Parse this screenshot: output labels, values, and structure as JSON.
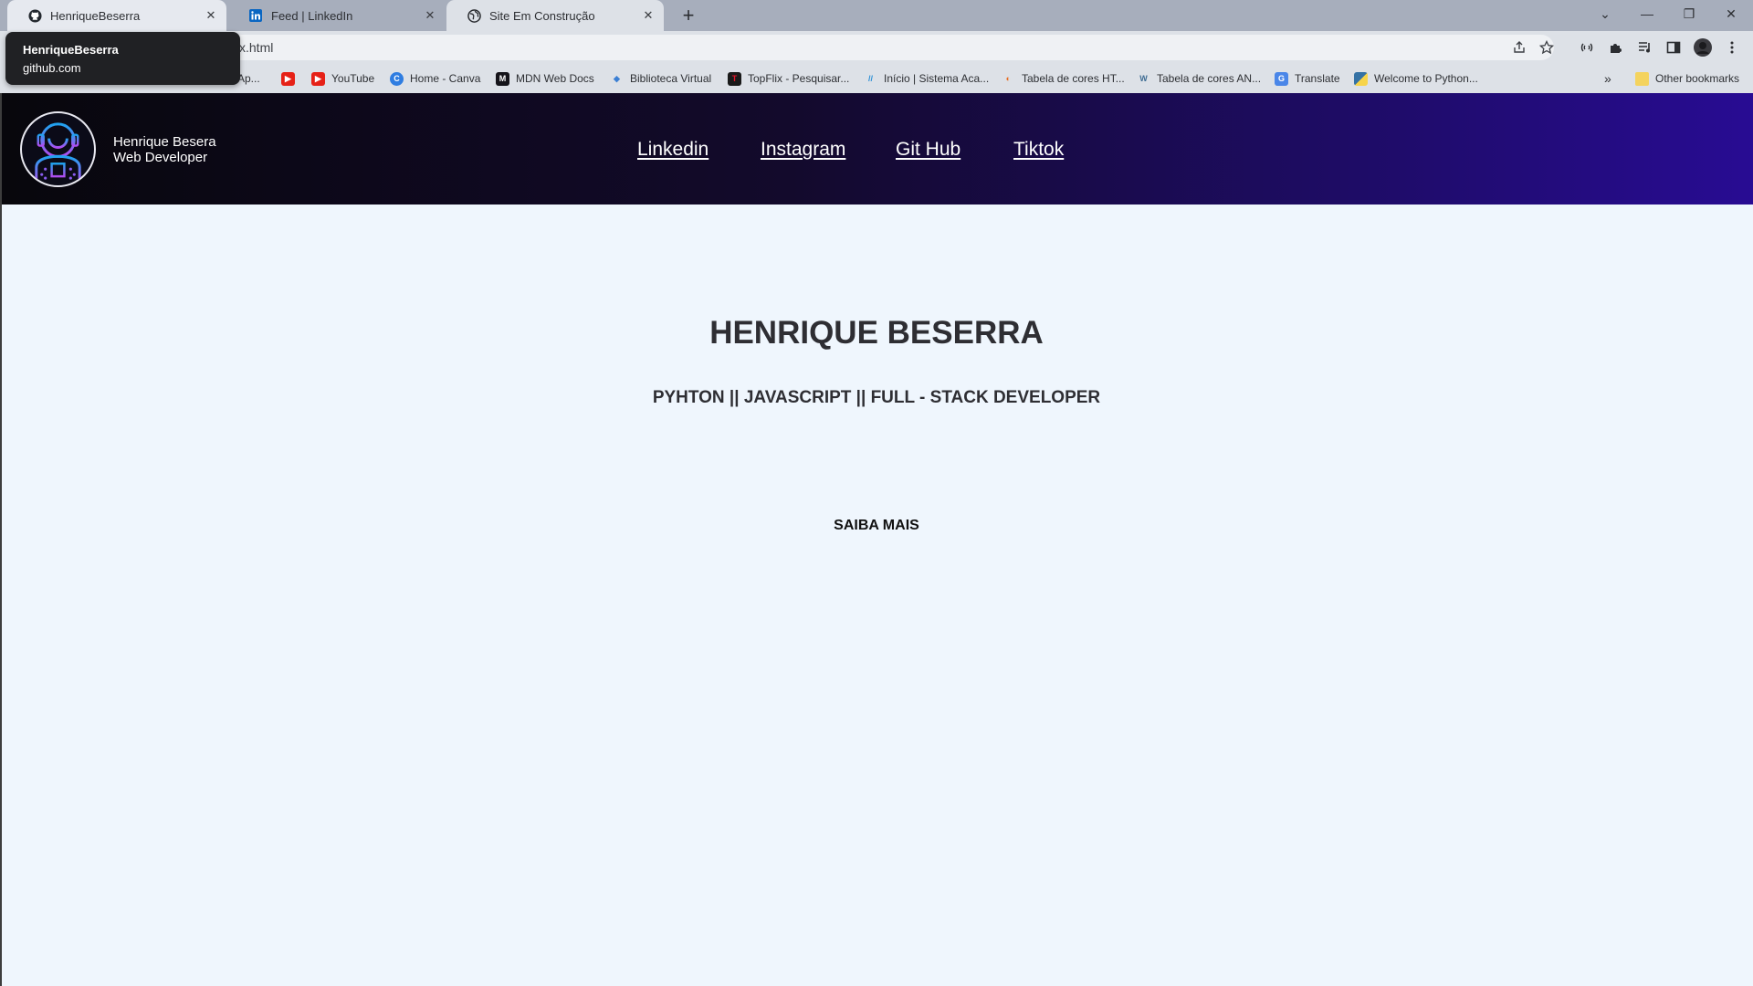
{
  "browser": {
    "tabs": [
      {
        "title": "HenriqueBeserra",
        "icon": "github-icon"
      },
      {
        "title": "Feed | LinkedIn",
        "icon": "linkedin-icon"
      },
      {
        "title": "Site Em Construção",
        "icon": "globe-icon"
      }
    ],
    "tooltip": {
      "title": "HenriqueBeserra",
      "subtitle": "github.com"
    },
    "address": "x.html",
    "bookmarks": [
      {
        "label": "Ap...",
        "icon": "apps-icon"
      },
      {
        "label": "",
        "icon": "youtube-icon"
      },
      {
        "label": "YouTube",
        "icon": "youtube-icon"
      },
      {
        "label": "Home - Canva",
        "icon": "canva-icon"
      },
      {
        "label": "MDN Web Docs",
        "icon": "mdn-icon"
      },
      {
        "label": "Biblioteca Virtual",
        "icon": "biblioteca-icon"
      },
      {
        "label": "TopFlix - Pesquisar...",
        "icon": "topflix-icon"
      },
      {
        "label": "Início | Sistema Aca...",
        "icon": "sistema-icon"
      },
      {
        "label": "Tabela de cores HT...",
        "icon": "colors-icon"
      },
      {
        "label": "Tabela de cores AN...",
        "icon": "wordpress-icon"
      },
      {
        "label": "Translate",
        "icon": "translate-icon"
      },
      {
        "label": "Welcome to Python...",
        "icon": "python-icon"
      }
    ],
    "other_bookmarks": "Other bookmarks",
    "more_bookmarks": "»"
  },
  "site": {
    "brand_name": "Henrique Besera",
    "brand_role": "Web Developer",
    "nav": [
      "Linkedin",
      "Instagram",
      "Git Hub",
      "Tiktok"
    ],
    "hero_title": "HENRIQUE BESERRA",
    "hero_subtitle": "PYHTON || JAVASCRIPT || FULL - STACK DEVELOPER",
    "cta": "SAIBA MAIS"
  },
  "colors": {
    "header_start": "#08070c",
    "header_end": "#280c93",
    "page_bg": "#eff6fd",
    "text_dark": "#2e2e33"
  }
}
